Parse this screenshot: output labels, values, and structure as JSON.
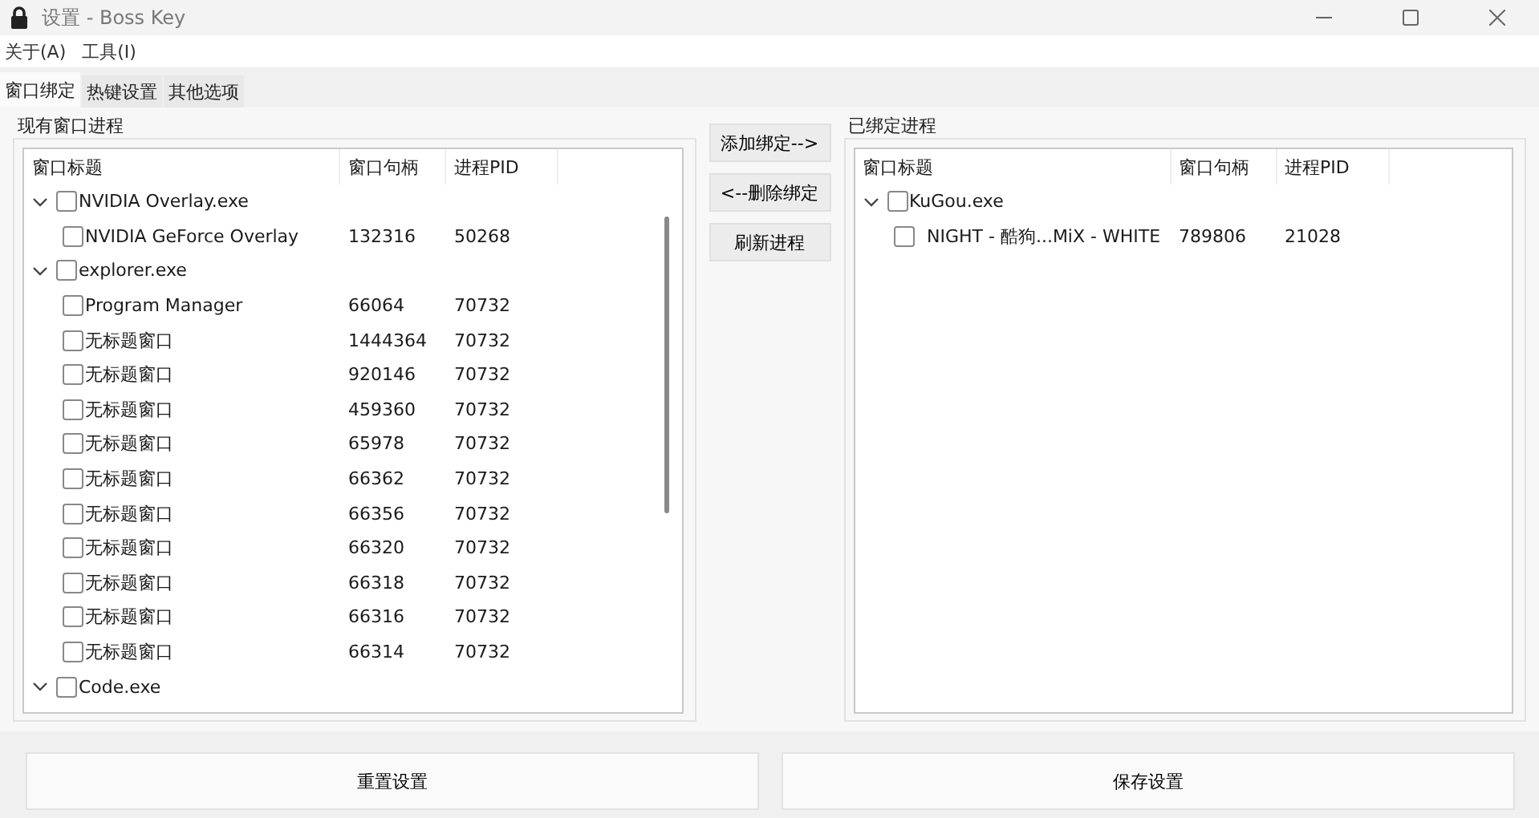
{
  "window": {
    "title": "设置 - Boss Key"
  },
  "menu": [
    "关于(A)",
    "工具(I)"
  ],
  "tabs": [
    {
      "label": "窗口绑定",
      "selected": true
    },
    {
      "label": "热键设置",
      "selected": false
    },
    {
      "label": "其他选项",
      "selected": false
    }
  ],
  "existing": {
    "title": "现有窗口进程",
    "columns": [
      "窗口标题",
      "窗口句柄",
      "进程PID"
    ],
    "items": [
      {
        "title": "NVIDIA Overlay.exe",
        "checked": false,
        "expanded": true,
        "children": [
          {
            "title": "NVIDIA GeForce Overlay",
            "handle": "132316",
            "pid": "50268",
            "checked": false
          }
        ]
      },
      {
        "title": "explorer.exe",
        "checked": false,
        "expanded": true,
        "children": [
          {
            "title": "Program Manager",
            "handle": "66064",
            "pid": "70732",
            "checked": false
          },
          {
            "title": "无标题窗口",
            "handle": "1444364",
            "pid": "70732",
            "checked": false
          },
          {
            "title": "无标题窗口",
            "handle": "920146",
            "pid": "70732",
            "checked": false
          },
          {
            "title": "无标题窗口",
            "handle": "459360",
            "pid": "70732",
            "checked": false
          },
          {
            "title": "无标题窗口",
            "handle": "65978",
            "pid": "70732",
            "checked": false
          },
          {
            "title": "无标题窗口",
            "handle": "66362",
            "pid": "70732",
            "checked": false
          },
          {
            "title": "无标题窗口",
            "handle": "66356",
            "pid": "70732",
            "checked": false
          },
          {
            "title": "无标题窗口",
            "handle": "66320",
            "pid": "70732",
            "checked": false
          },
          {
            "title": "无标题窗口",
            "handle": "66318",
            "pid": "70732",
            "checked": false
          },
          {
            "title": "无标题窗口",
            "handle": "66316",
            "pid": "70732",
            "checked": false
          },
          {
            "title": "无标题窗口",
            "handle": "66314",
            "pid": "70732",
            "checked": false
          }
        ]
      },
      {
        "title": "Code.exe",
        "checked": false,
        "expanded": true
      }
    ]
  },
  "actions": [
    "添加绑定-->",
    "<--删除绑定",
    "刷新进程"
  ],
  "bound": {
    "title": "已绑定进程",
    "columns": [
      "窗口标题",
      "窗口句柄",
      "进程PID"
    ],
    "items": [
      {
        "title": "KuGou.exe",
        "checked": false,
        "expanded": true,
        "children": [
          {
            "title": "NIGHT - 酷狗...MiX - WHITE",
            "handle": "789806",
            "pid": "21028",
            "checked": false
          }
        ]
      }
    ]
  },
  "footer": [
    "重置设置",
    "保存设置"
  ]
}
